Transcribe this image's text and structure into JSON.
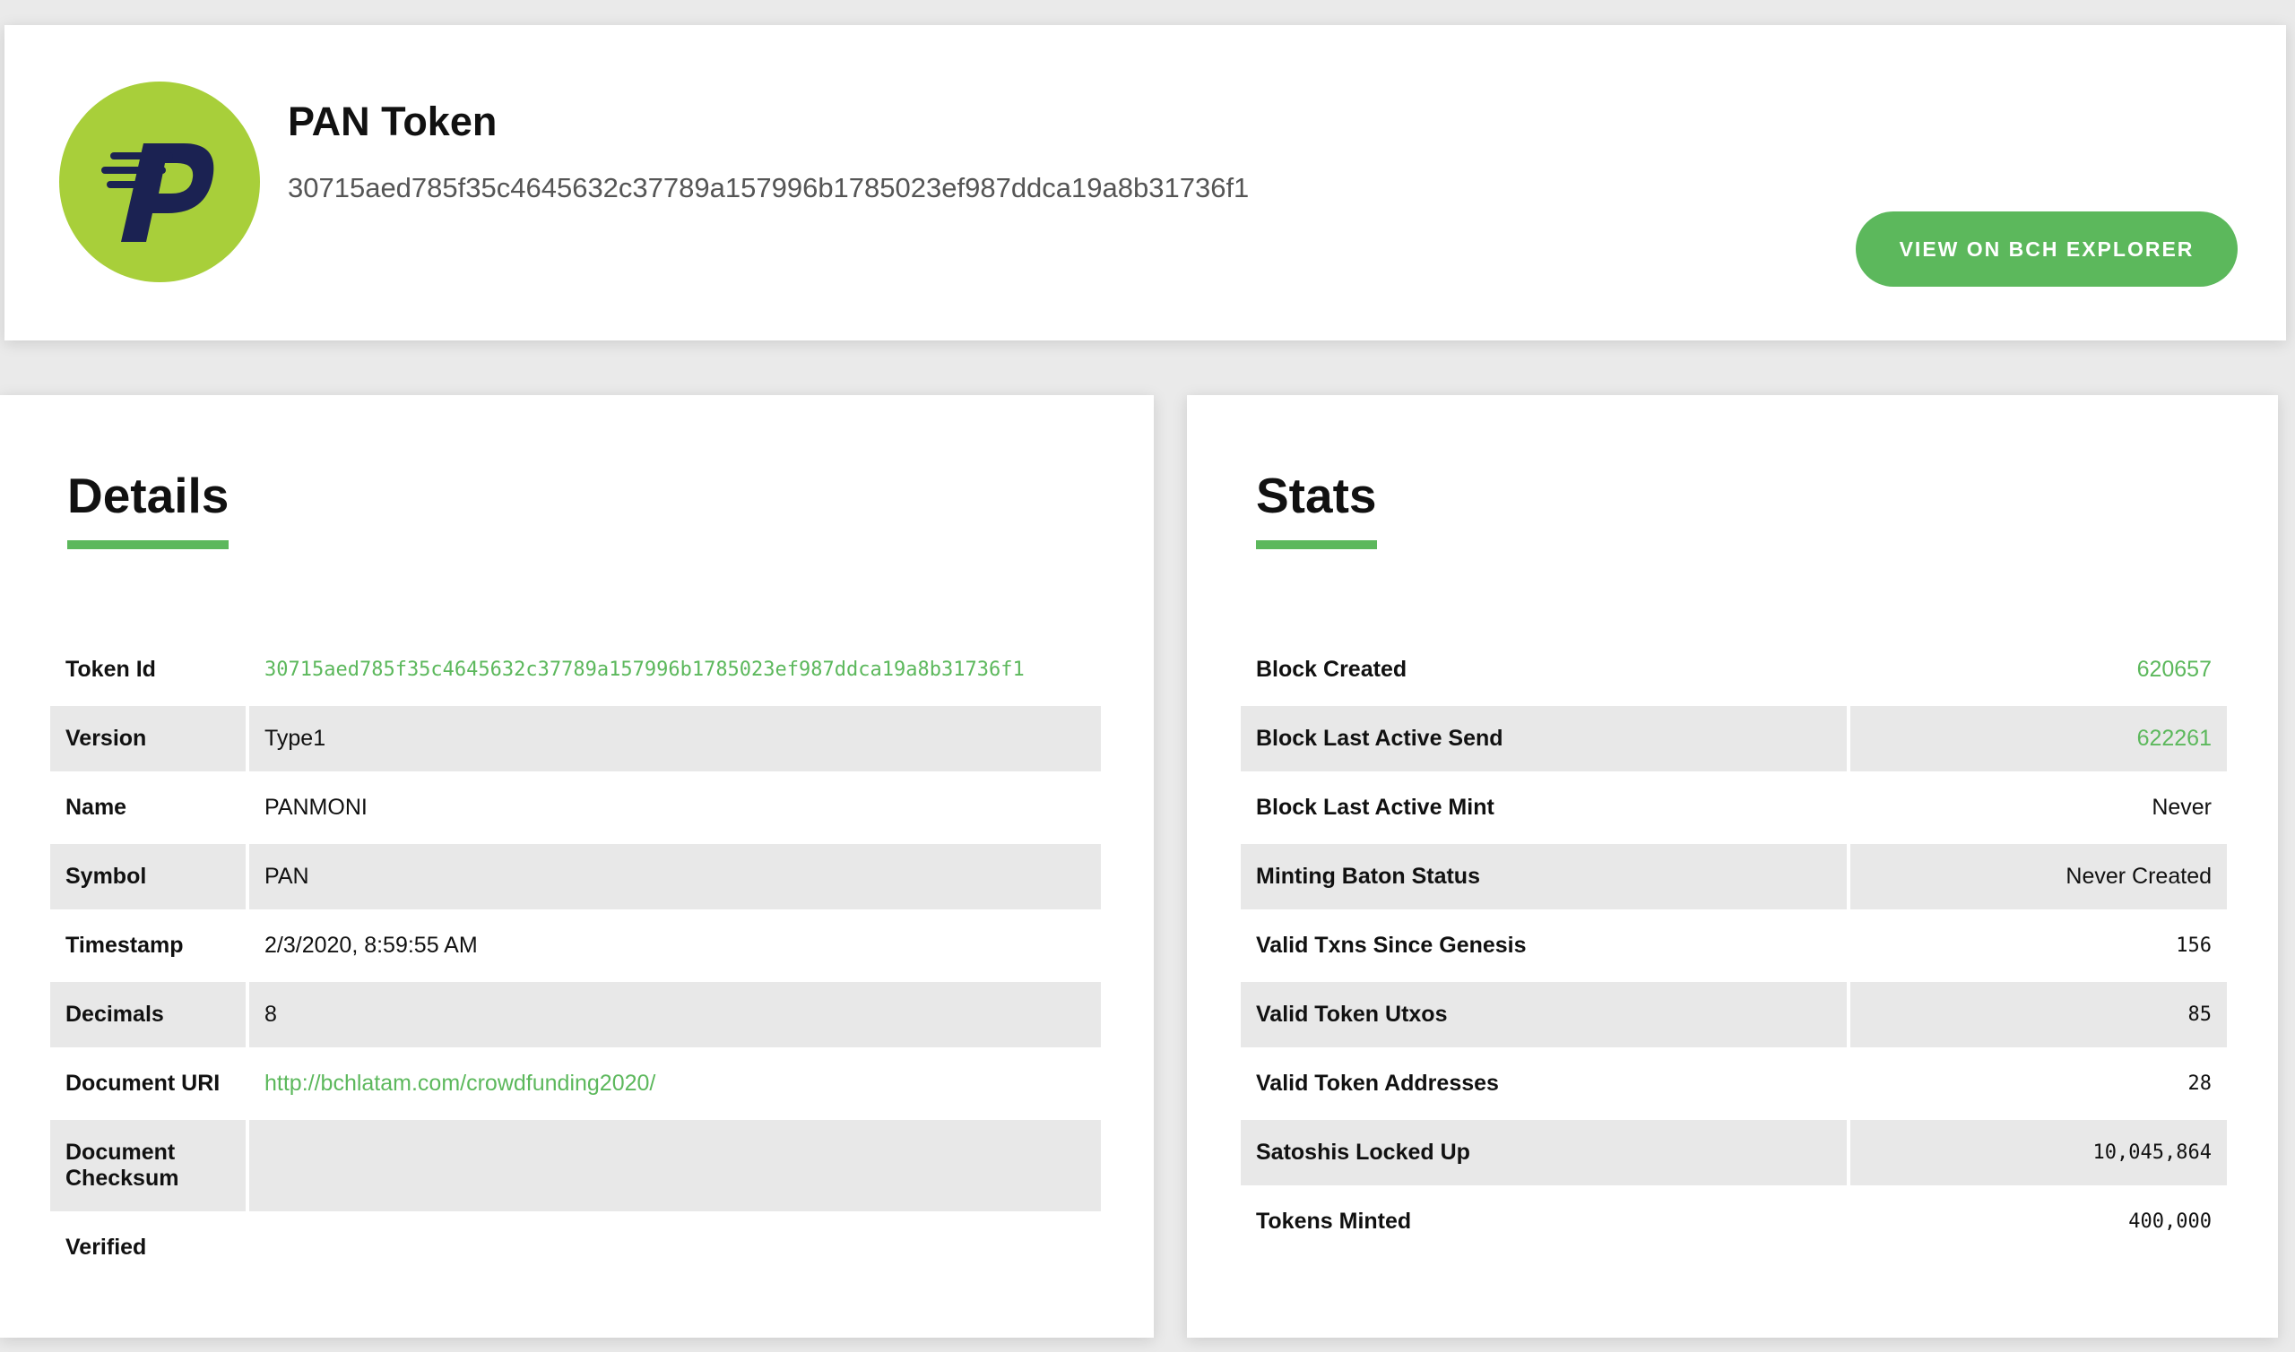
{
  "header": {
    "logo_icon": "panmoni-logo-icon",
    "title": "PAN Token",
    "hash": "30715aed785f35c4645632c37789a157996b1785023ef987ddca19a8b31736f1",
    "explorer_button": "VIEW ON BCH EXPLORER"
  },
  "details": {
    "title": "Details",
    "rows": [
      {
        "label": "Token Id",
        "value": "30715aed785f35c4645632c37789a157996b1785023ef987ddca19a8b31736f1"
      },
      {
        "label": "Version",
        "value": "Type1"
      },
      {
        "label": "Name",
        "value": "PANMONI"
      },
      {
        "label": "Symbol",
        "value": "PAN"
      },
      {
        "label": "Timestamp",
        "value": "2/3/2020, 8:59:55 AM"
      },
      {
        "label": "Decimals",
        "value": "8"
      },
      {
        "label": "Document URI",
        "value": "http://bchlatam.com/crowdfunding2020/"
      },
      {
        "label": "Document Checksum",
        "value": ""
      },
      {
        "label": "Verified",
        "value": ""
      }
    ]
  },
  "stats": {
    "title": "Stats",
    "rows": [
      {
        "label": "Block Created",
        "value": "620657"
      },
      {
        "label": "Block Last Active Send",
        "value": "622261"
      },
      {
        "label": "Block Last Active Mint",
        "value": "Never"
      },
      {
        "label": "Minting Baton Status",
        "value": "Never Created"
      },
      {
        "label": "Valid Txns Since Genesis",
        "value": "156"
      },
      {
        "label": "Valid Token Utxos",
        "value": "85"
      },
      {
        "label": "Valid Token Addresses",
        "value": "28"
      },
      {
        "label": "Satoshis Locked Up",
        "value": "10,045,864"
      },
      {
        "label": "Tokens Minted",
        "value": "400,000"
      }
    ]
  },
  "colors": {
    "accent": "#5cb85c",
    "row_shade": "#e8e8e8",
    "logo_green": "#a8cf3a",
    "logo_navy": "#1b2252"
  }
}
